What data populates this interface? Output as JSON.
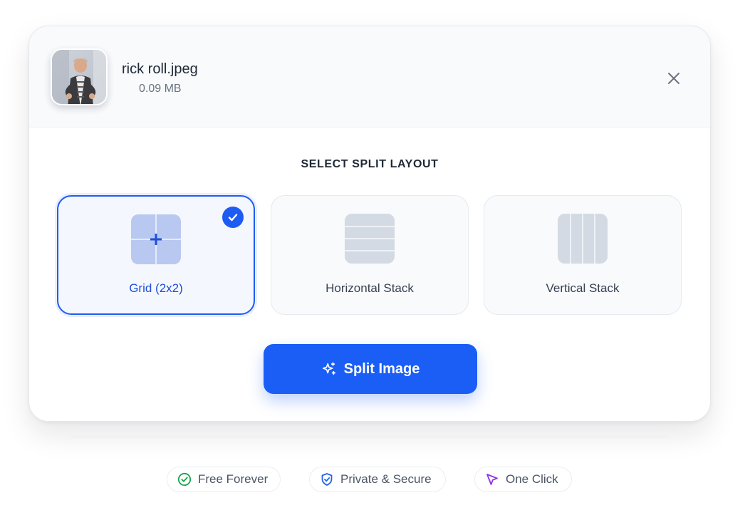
{
  "file": {
    "name": "rick roll.jpeg",
    "size": "0.09 MB"
  },
  "section_title": "SELECT SPLIT LAYOUT",
  "layouts": [
    {
      "label": "Grid (2x2)",
      "icon": "grid-2x2-icon",
      "selected": true
    },
    {
      "label": "Horizontal Stack",
      "icon": "horizontal-stack-icon",
      "selected": false
    },
    {
      "label": "Vertical Stack",
      "icon": "vertical-stack-icon",
      "selected": false
    }
  ],
  "split_button": {
    "label": "Split Image",
    "icon": "sparkles-icon"
  },
  "features": [
    {
      "label": "Free Forever",
      "icon": "check-circle-icon",
      "color": "#16a34a"
    },
    {
      "label": "Private & Secure",
      "icon": "shield-check-icon",
      "color": "#2563eb"
    },
    {
      "label": "One Click",
      "icon": "cursor-icon",
      "color": "#9333ea"
    }
  ],
  "colors": {
    "accent": "#1a5ef5",
    "selected_border": "#1d5cf2",
    "card_header_bg": "#f8fafc"
  }
}
